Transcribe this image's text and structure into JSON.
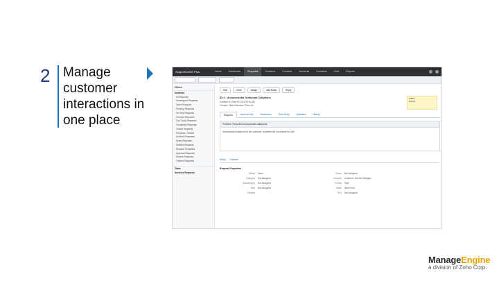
{
  "slide": {
    "number": "2",
    "headline": "Manage customer interactions in one place"
  },
  "screenshot": {
    "brand": "SupportCenter Plus",
    "nav": [
      "Home",
      "Dashboard",
      "Requests",
      "Solutions",
      "Contacts",
      "Accounts",
      "Contracts",
      "Chat",
      "Reports"
    ],
    "sidebar_header": "Filters",
    "sidebar_items": [
      "Incidents",
      "All Requests",
      "Unassigned Requests",
      "Open Requests",
      "Pending Requests",
      "On Hold Requests",
      "Overdue Requests",
      "Due Today Requests",
      "Completed Requests",
      "Closed Requests",
      "Requests I Raised",
      "Archived Requests",
      "Spam Requests",
      "Deleted Requests",
      "Request Templates",
      "Approval Requests",
      "Service Requests",
      "Trashed Requests"
    ],
    "sidebar_bottom": [
      "Tasks",
      "Archived Requests"
    ],
    "toolbar": [
      "Edit",
      "Close",
      "Assign",
      "Add Notes",
      "Reply"
    ],
    "request_title": "ID:1 - Unsuccessful Outbound Callphone",
    "meta": [
      "Created On: Mar 05 2013 09:41 AM",
      "Contact: Peter Robinson, Zone Inc."
    ],
    "tabs": [
      "Request",
      "Account Info",
      "Resolution",
      "Time Entry",
      "Activities",
      "History"
    ],
    "desc_header": "Problem: Reported unsuccessful callphone",
    "desc_body": "Unsuccessful callphone to the customer, customer did not answer the call.",
    "sec_links": [
      "Reply",
      "Forward"
    ],
    "props_title": "Request Properties",
    "props": [
      [
        "Status",
        "Open",
        "Group",
        "Not Assigned"
      ],
      [
        "Category",
        "Not Assigned",
        "Account",
        "Customer Service Manager"
      ],
      [
        "Subcategory",
        "Not Assigned",
        "Priority",
        "High"
      ],
      [
        "Item",
        "Not Assigned",
        "Mode",
        "Web Form"
      ],
      [
        "Created",
        "-",
        "SLA",
        "Not Assigned"
      ]
    ]
  },
  "logo": {
    "name_part1": "Manage",
    "name_part2": "Engine",
    "tagline": "a division of Zoho Corp."
  }
}
